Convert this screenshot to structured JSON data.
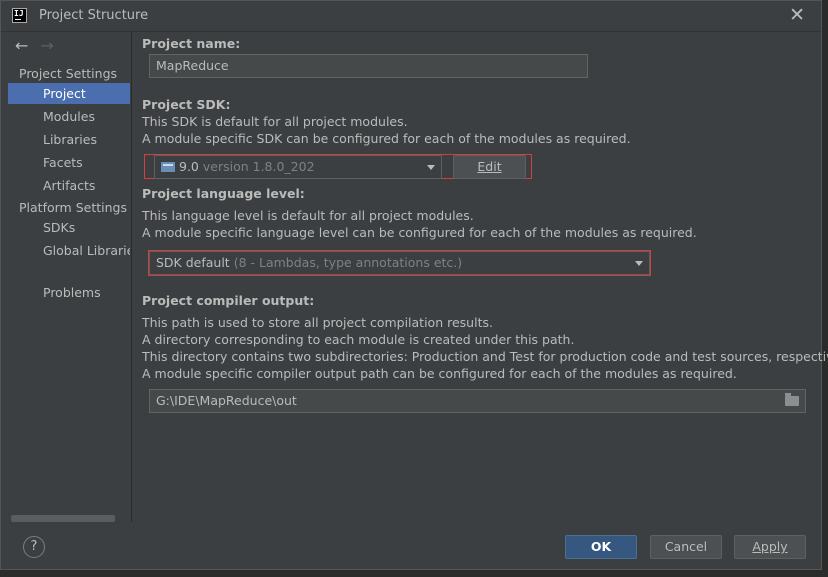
{
  "window": {
    "title": "Project Structure"
  },
  "sidebar": {
    "group_project": "Project Settings",
    "items_project": [
      "Project",
      "Modules",
      "Libraries",
      "Facets",
      "Artifacts"
    ],
    "group_platform": "Platform Settings",
    "items_platform": [
      "SDKs",
      "Global Libraries"
    ],
    "problems": "Problems",
    "selected": "Project"
  },
  "project": {
    "name_label": "Project name:",
    "name_value": "MapReduce",
    "sdk_label": "Project SDK:",
    "sdk_desc_1": "This SDK is default for all project modules.",
    "sdk_desc_2": "A module specific SDK can be configured for each of the modules as required.",
    "sdk_name": "9.0",
    "sdk_version": "version 1.8.0_202",
    "sdk_edit": "Edit",
    "lang_label": "Project language level:",
    "lang_desc_1": "This language level is default for all project modules.",
    "lang_desc_2": "A module specific language level can be configured for each of the modules as required.",
    "lang_value": "SDK default",
    "lang_hint": "(8 - Lambdas, type annotations etc.)",
    "out_label": "Project compiler output:",
    "out_desc_1": "This path is used to store all project compilation results.",
    "out_desc_2": "A directory corresponding to each module is created under this path.",
    "out_desc_3": "This directory contains two subdirectories: Production and Test for production code and test sources, respectively.",
    "out_desc_4": "A module specific compiler output path can be configured for each of the modules as required.",
    "out_value": "G:\\IDE\\MapReduce\\out"
  },
  "footer": {
    "help": "?",
    "ok": "OK",
    "cancel": "Cancel",
    "apply": "Apply"
  },
  "colors": {
    "selection": "#4b6eaf",
    "default_button": "#365880",
    "highlight_box": "#d13f3f"
  },
  "icons": [
    "app-icon",
    "close-icon",
    "back-arrow-icon",
    "forward-arrow-icon",
    "sdk-folder-icon",
    "dropdown-arrow-icon",
    "folder-browse-icon",
    "help-icon"
  ]
}
